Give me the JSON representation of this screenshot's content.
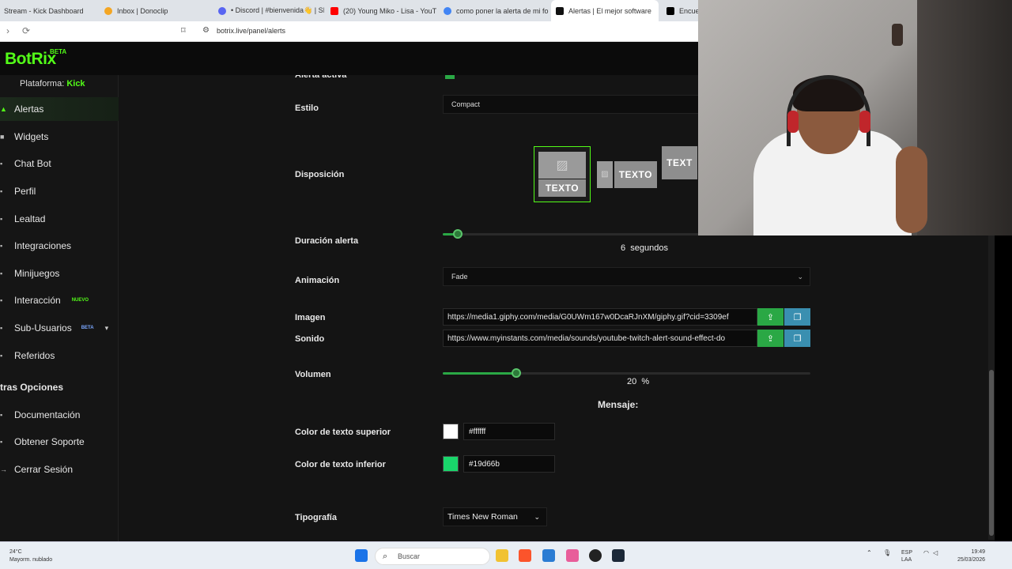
{
  "browser": {
    "tabs": [
      {
        "title": "Stream - Kick Dashboard",
        "color": "#53fc18"
      },
      {
        "title": "Inbox | Donoclip",
        "color": "#f4a623"
      },
      {
        "title": "• Discord | #bienvenida👋 | SI",
        "color": "#5865f2"
      },
      {
        "title": "(20) Young Miko - Lisa - YouTu",
        "color": "#ff0000"
      },
      {
        "title": "como poner la alerta de mi fo",
        "color": "#4285f4"
      },
      {
        "title": "Alertas | El mejor software",
        "color": "#111111",
        "active": true
      },
      {
        "title": "Encue",
        "color": "#000000"
      }
    ],
    "close_glyph": "✕",
    "url": "botrix.live/panel/alerts"
  },
  "app": {
    "logo": "BotRix",
    "logo_badge": "BETA",
    "accent": "#53fc18"
  },
  "sidebar": {
    "platform_label": "Plataforma:",
    "platform_value": "Kick",
    "items": [
      {
        "label": "Alertas",
        "icon": "bell-icon",
        "active": true
      },
      {
        "label": "Widgets",
        "icon": "grid-icon"
      },
      {
        "label": "Chat Bot",
        "icon": "chat-icon"
      },
      {
        "label": "Perfil",
        "icon": "user-icon"
      },
      {
        "label": "Lealtad",
        "icon": "star-icon"
      },
      {
        "label": "Integraciones",
        "icon": "plug-icon"
      },
      {
        "label": "Minijuegos",
        "icon": "gamepad-icon"
      },
      {
        "label": "Interacción",
        "icon": "hand-icon",
        "tag": "NUEVO"
      },
      {
        "label": "Sub-Usuarios",
        "icon": "users-icon",
        "tag": "BETA"
      },
      {
        "label": "Referidos",
        "icon": "share-icon"
      }
    ],
    "section_title": "tras Opciones",
    "other_items": [
      {
        "label": "Documentación",
        "icon": "doc-icon"
      },
      {
        "label": "Obtener Soporte",
        "icon": "support-icon"
      },
      {
        "label": "Cerrar Sesión",
        "icon": "logout-icon"
      }
    ]
  },
  "form": {
    "cut_label": "Alerta activa",
    "estilo_label": "Estilo",
    "estilo_value": "Compact",
    "disposicion_label": "Disposición",
    "layout_text": "TEXTO",
    "layout_text_cut": "TEXT",
    "duracion_label": "Duración alerta",
    "duracion_value": "6",
    "duracion_unit": "segundos",
    "duracion_fraction": 0.04,
    "animacion_label": "Animación",
    "animacion_value": "Fade",
    "imagen_label": "Imagen",
    "imagen_url": "https://media1.giphy.com/media/G0UWm167w0DcaRJnXM/giphy.gif?cid=3309ef",
    "sonido_label": "Sonido",
    "sonido_url": "https://www.myinstants.com/media/sounds/youtube-twitch-alert-sound-effect-do",
    "volumen_label": "Volumen",
    "volumen_value": "20",
    "volumen_unit": "%",
    "volumen_fraction": 0.2,
    "mensaje_label": "Mensaje:",
    "color_sup_label": "Color de texto superior",
    "color_sup_value": "#ffffff",
    "color_inf_label": "Color de texto inferior",
    "color_inf_value": "#19d66b",
    "tipografia_label": "Tipografía",
    "tipografia_value": "Times New Roman"
  },
  "taskbar": {
    "weather_temp": "24°C",
    "weather_desc": "Mayorm. nublado",
    "search_placeholder": "Buscar",
    "lang_1": "ESP",
    "lang_2": "LAA",
    "time": "19:49",
    "date": "25/03/2026"
  }
}
